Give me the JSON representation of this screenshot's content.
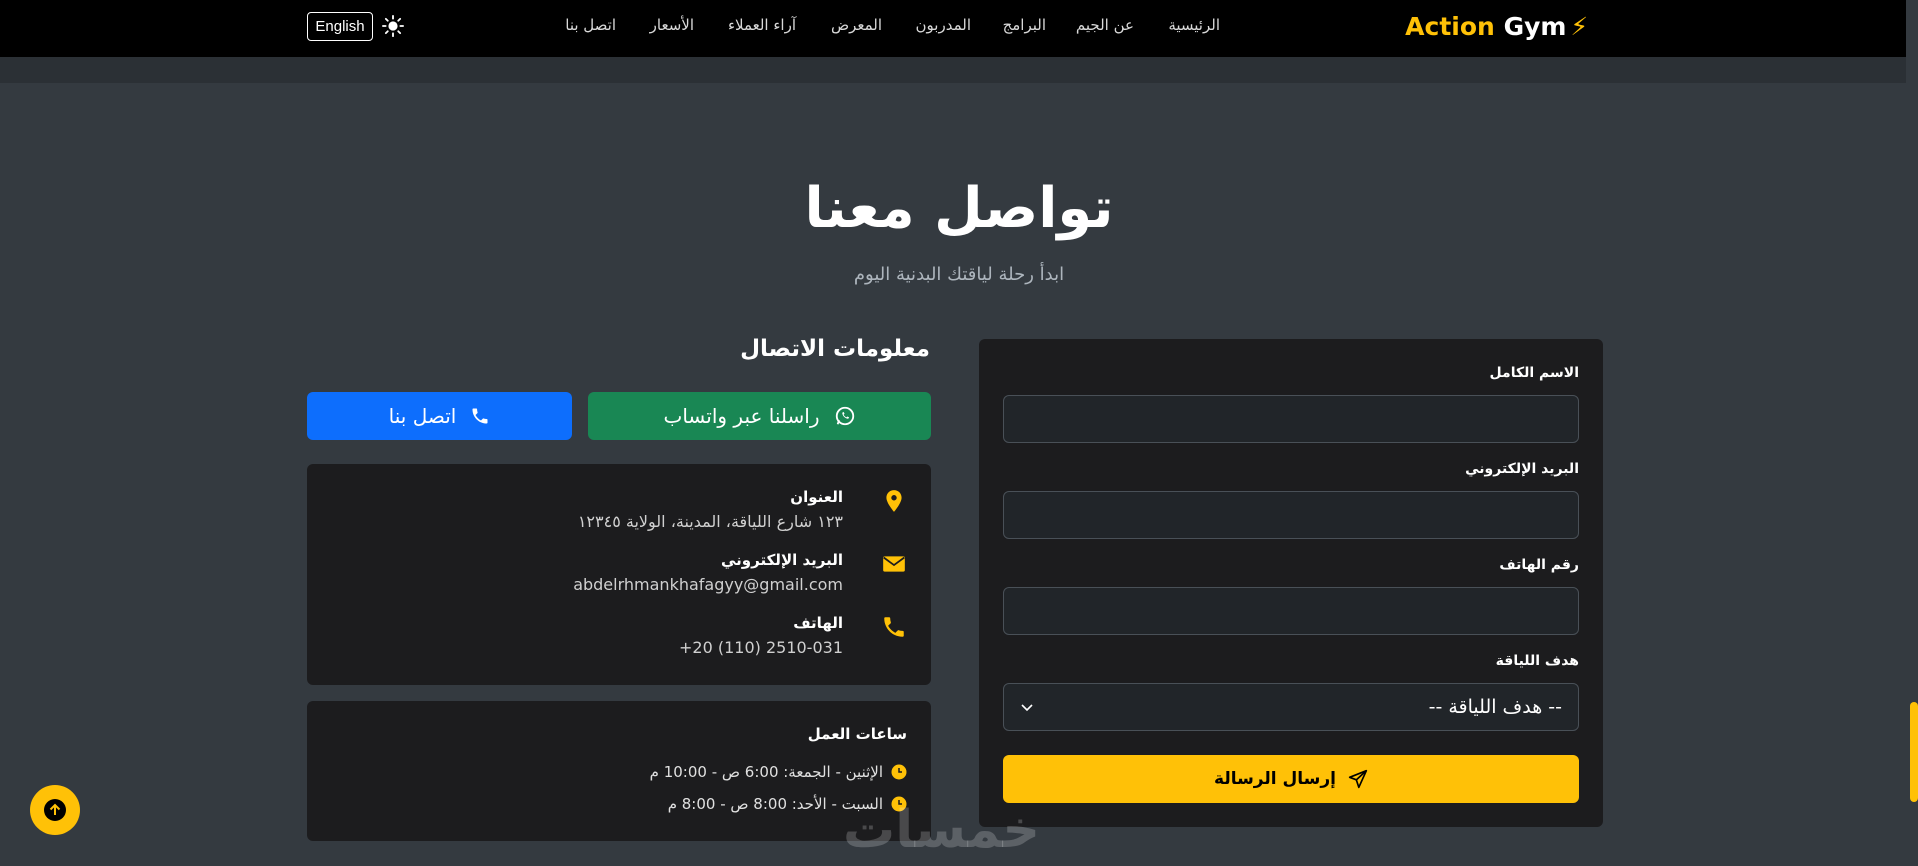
{
  "brand": {
    "word1": "Action",
    "word2": "Gym",
    "bolt": "⚡"
  },
  "nav": {
    "links": [
      "الرئيسية",
      "عن الجيم",
      "البرامج",
      "المدربون",
      "المعرض",
      "آراء العملاء",
      "الأسعار",
      "اتصل بنا"
    ],
    "language_button": "English",
    "theme_icon": "sun-icon"
  },
  "hero": {
    "title": "تواصل معنا",
    "subtitle": "ابدأ رحلة لياقتك البدنية اليوم"
  },
  "contact_info": {
    "heading": "معلومات الاتصال",
    "whatsapp_button": "راسلنا عبر واتساب",
    "call_button": "اتصل بنا",
    "address_label": "العنوان",
    "address_value": "١٢٣ شارع اللياقة، المدينة، الولاية ١٢٣٤٥",
    "email_label": "البريد الإلكتروني",
    "email_value": "abdelrhmankhafagyy@gmail.com",
    "phone_label": "الهاتف",
    "phone_value": "+20 (110) 2510-031"
  },
  "hours": {
    "title": "ساعات العمل",
    "weekdays": "الإثنين - الجمعة: 6:00 ص - 10:00 م",
    "weekend": "السبت - الأحد: 8:00 ص - 8:00 م"
  },
  "form": {
    "name_label": "الاسم الكامل",
    "email_label": "البريد الإلكتروني",
    "phone_label": "رقم الهاتف",
    "goal_label": "هدف اللياقة",
    "goal_selected": "-- هدف اللياقة --",
    "submit_label": "إرسال الرسالة"
  },
  "watermark": "خمسات",
  "colors": {
    "accent": "#ffc107",
    "whatsapp": "#198754",
    "call": "#0d6efd",
    "background": "#343a40",
    "card": "#1c1c1e"
  }
}
